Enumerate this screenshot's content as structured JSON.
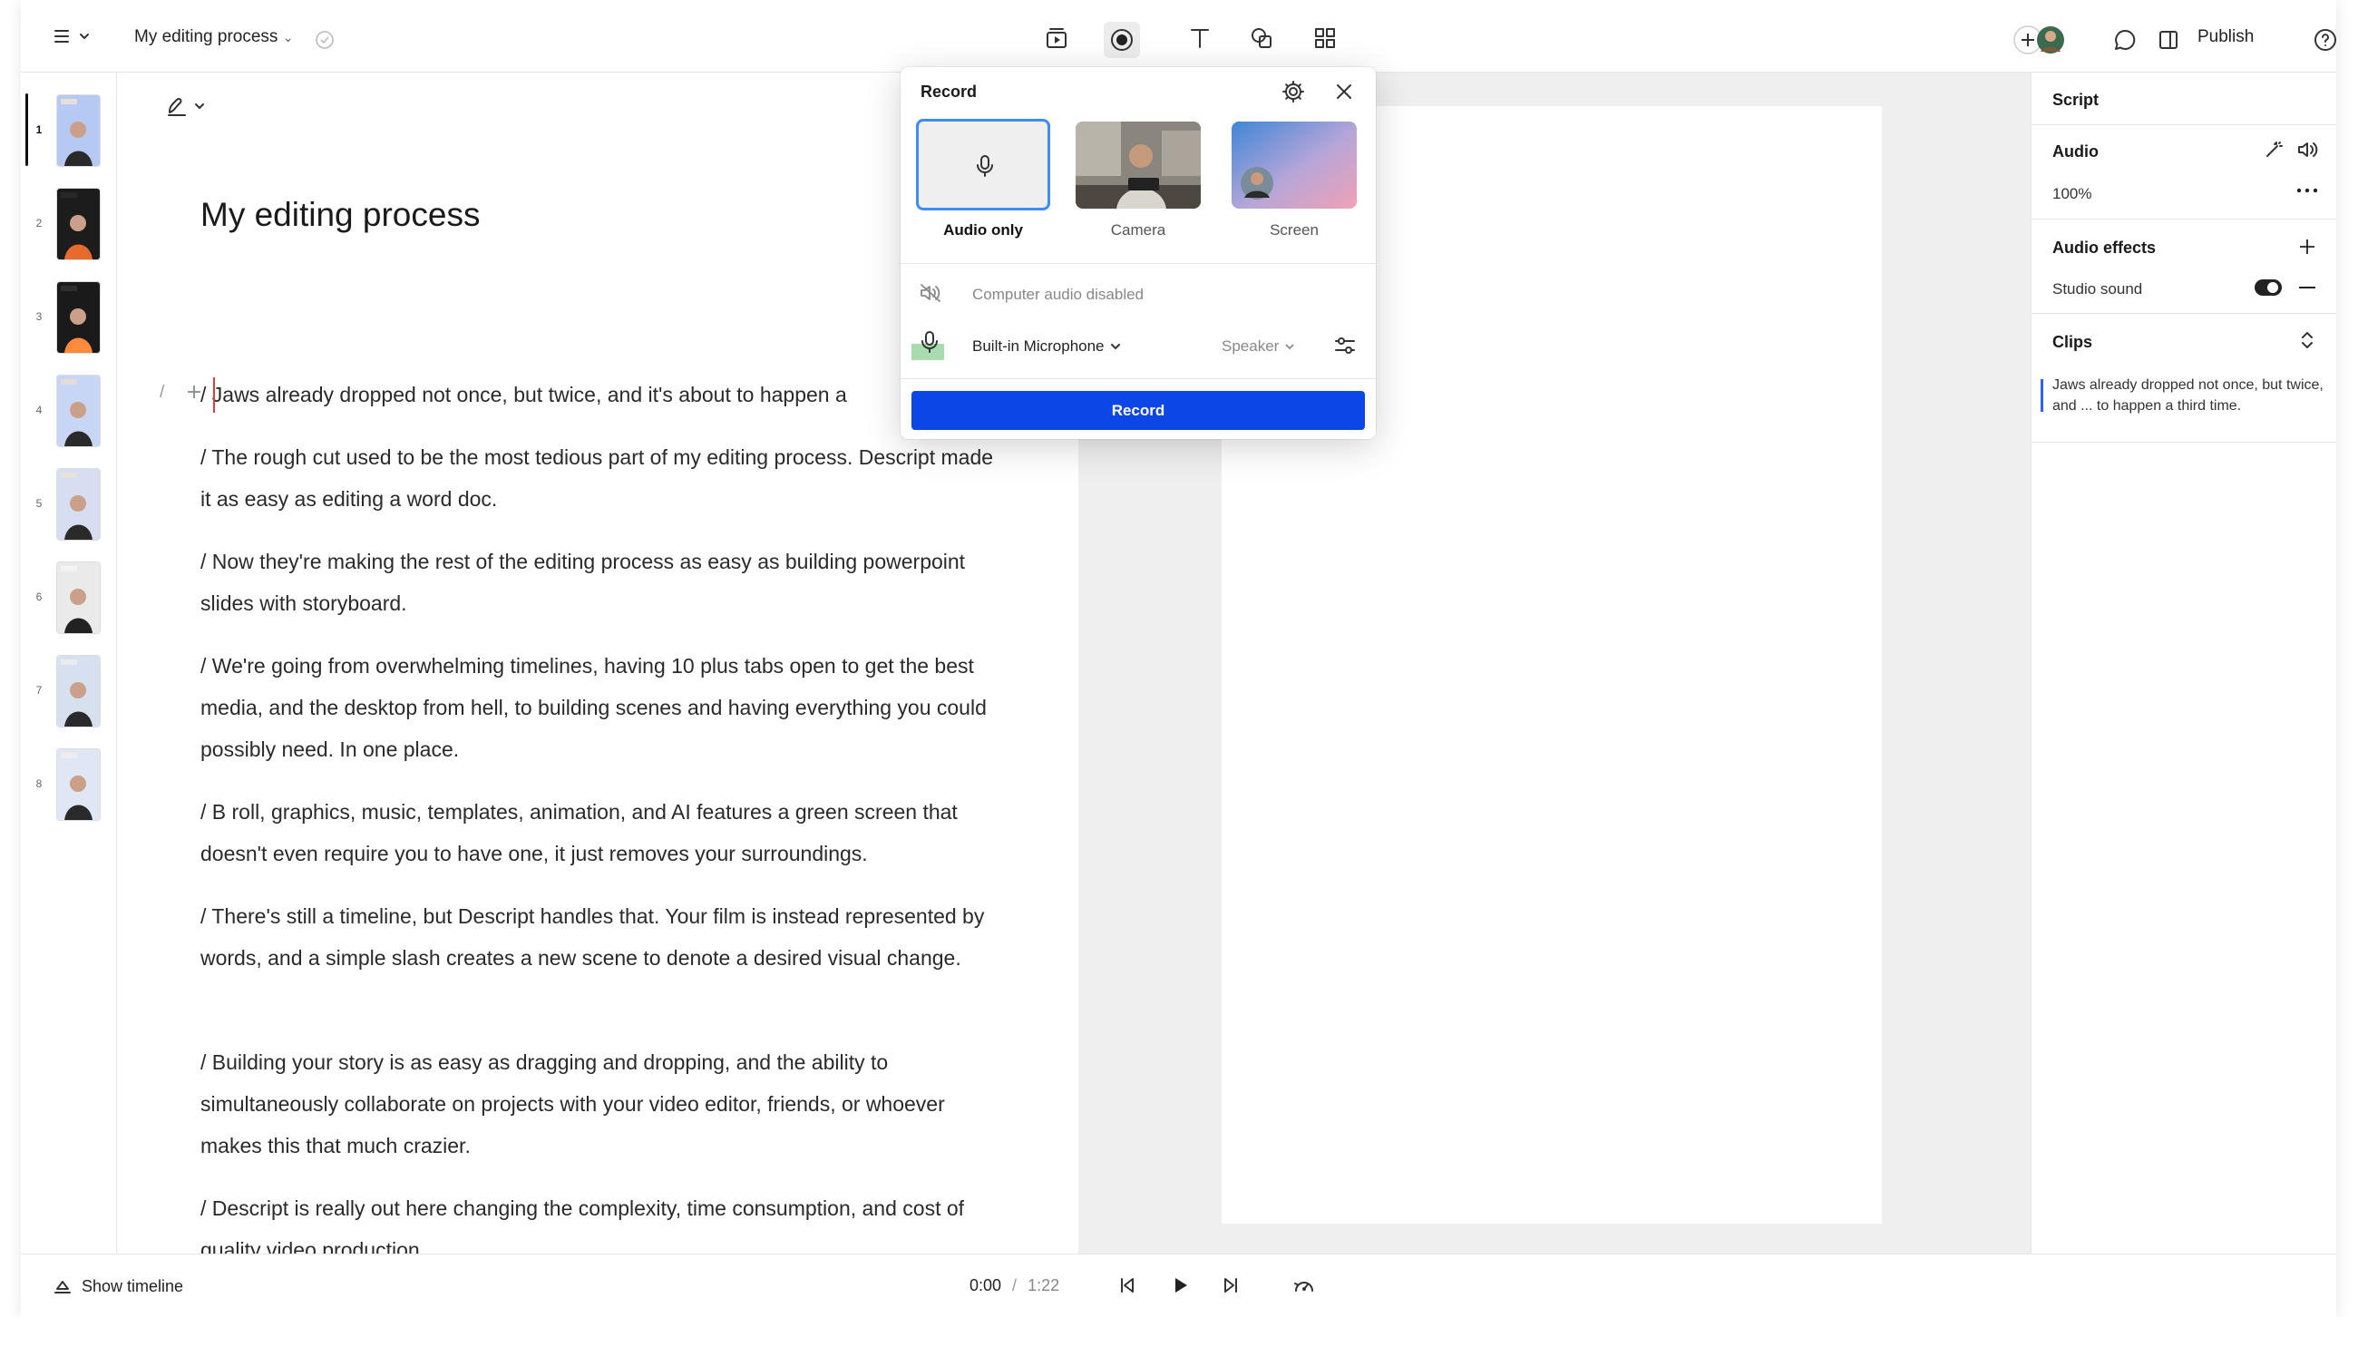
{
  "header": {
    "project_title": "My editing process",
    "publish_label": "Publish",
    "icons": [
      "menu-icon",
      "check-circle-icon",
      "scene-icon",
      "record-icon",
      "text-icon",
      "shapes-icon",
      "grid-icon",
      "add-collaborator-icon",
      "comment-icon",
      "panel-icon",
      "help-icon"
    ]
  },
  "slides": [
    {
      "num": "1",
      "active": true
    },
    {
      "num": "2"
    },
    {
      "num": "3"
    },
    {
      "num": "4"
    },
    {
      "num": "5"
    },
    {
      "num": "6"
    },
    {
      "num": "7"
    },
    {
      "num": "8"
    }
  ],
  "editor": {
    "doc_title": "My editing process",
    "paragraphs": [
      "/ Jaws already dropped not once, but twice, and it's about to happen a",
      "/ The rough cut used to be the most tedious part of my editing process. Descript made it as easy as editing a word doc.",
      "/ Now they're making the rest of the editing process as easy as building powerpoint slides with storyboard.",
      "/ We're going from overwhelming timelines, having 10 plus tabs open to get the best media, and the desktop from hell, to building scenes and having everything you could possibly need. In one place.",
      "/ B roll, graphics, music, templates, animation, and AI features a green screen that doesn't even require you to have one, it just removes your surroundings.",
      "/ There's still a timeline, but Descript handles that. Your film is instead represented by words, and a simple slash creates a new scene to denote a desired visual change.",
      "/ Building your story is as easy as dragging and dropping, and the ability to simultaneously collaborate on projects with your video editor, friends, or whoever makes this that much crazier.",
      "/ Descript is really out here changing the complexity, time consumption, and cost of quality video production."
    ],
    "gutter_slash": "/"
  },
  "record_popup": {
    "title": "Record",
    "sources": [
      {
        "label": "Audio only",
        "selected": true
      },
      {
        "label": "Camera",
        "selected": false
      },
      {
        "label": "Screen",
        "selected": false
      }
    ],
    "computer_audio": "Computer audio disabled",
    "microphone": "Built-in Microphone",
    "speaker": "Speaker",
    "record_button": "Record",
    "colors": {
      "accent": "#0c46e6",
      "selected_border": "#3d8bfd"
    }
  },
  "right_panel": {
    "script_label": "Script",
    "audio_label": "Audio",
    "volume": "100%",
    "audio_effects_label": "Audio effects",
    "studio_sound_label": "Studio sound",
    "studio_sound_on": true,
    "clips_label": "Clips",
    "clip_text": "Jaws already dropped not once, but twice, and ... to happen a third time."
  },
  "bottom_bar": {
    "show_timeline": "Show timeline",
    "current_time": "0:00",
    "separator": "/",
    "total_time": "1:22"
  }
}
